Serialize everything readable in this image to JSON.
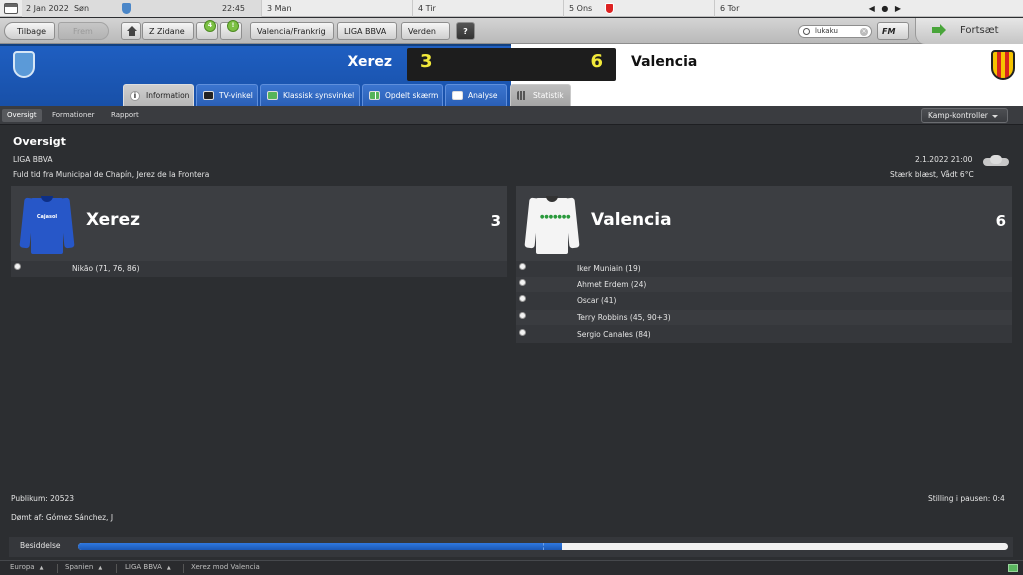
{
  "calendar": {
    "today_label": "2 Jan 2022",
    "today_day": "Søn",
    "today_time": "22:45",
    "days": [
      {
        "num": "3",
        "day": "Man"
      },
      {
        "num": "4",
        "day": "Tir"
      },
      {
        "num": "5",
        "day": "Ons"
      },
      {
        "num": "6",
        "day": "Tor"
      }
    ],
    "nav": {
      "prev": "◀",
      "dot": "●",
      "next": "▶"
    }
  },
  "toolbar": {
    "back_label": "Tilbage",
    "forward_label": "Frem",
    "manager_label": "Z Zidane",
    "inbox_count": "4",
    "alert_count": "!",
    "nation_label": "Valencia/Frankrig",
    "competition_label": "LIGA BBVA",
    "world_label": "Verden",
    "help_label": "?",
    "search_value": "lukaku",
    "fm_label": "FM",
    "continue_label": "Fortsæt"
  },
  "match": {
    "home_team": "Xerez",
    "away_team": "Valencia",
    "home_score": "3",
    "away_score": "6",
    "home_color": "#1f5fc2",
    "score_color": "#f2e93a"
  },
  "tabs": [
    {
      "label": "Information",
      "icon": "info-icon"
    },
    {
      "label": "TV-vinkel",
      "icon": "tv-icon"
    },
    {
      "label": "Klassisk synsvinkel",
      "icon": "pitch-icon"
    },
    {
      "label": "Opdelt skærm",
      "icon": "split-screen-icon"
    },
    {
      "label": "Analyse",
      "icon": "analysis-icon"
    },
    {
      "label": "Statistik",
      "icon": "stats-icon"
    }
  ],
  "subtabs": [
    "Oversigt",
    "Formationer",
    "Rapport"
  ],
  "match_controls_label": "Kamp-kontroller",
  "overview": {
    "title": "Oversigt",
    "competition": "LIGA BBVA",
    "venue": "Fuld tid fra Municipal de Chapín, Jerez de la Frontera",
    "datetime": "2.1.2022 21:00",
    "weather": "Stærk blæst, Vådt 6°C",
    "weather_icon": "cloud-icon"
  },
  "home_card": {
    "name": "Xerez",
    "score": "3",
    "sponsor": "Cajasol",
    "scorers": [
      "Nikão (71, 76, 86)"
    ]
  },
  "away_card": {
    "name": "Valencia",
    "score": "6",
    "sponsor": "●●●●●●●",
    "scorers": [
      "Iker Muniain (19)",
      "Ahmet Erdem (24)",
      "Oscar (41)",
      "Terry Robbins (45, 90+3)",
      "Sergio Canales (84)"
    ]
  },
  "footer": {
    "attendance": "Publikum: 20523",
    "referee": "Dømt af: Gómez Sánchez, J",
    "halftime": "Stilling i pausen: 0:4"
  },
  "possession": {
    "label": "Besiddelse",
    "home_fraction": 0.52
  },
  "breadcrumbs": [
    "Europa",
    "Spanien",
    "LIGA BBVA",
    "Xerez mod Valencia"
  ],
  "breadcrumb_arrow": "▲"
}
